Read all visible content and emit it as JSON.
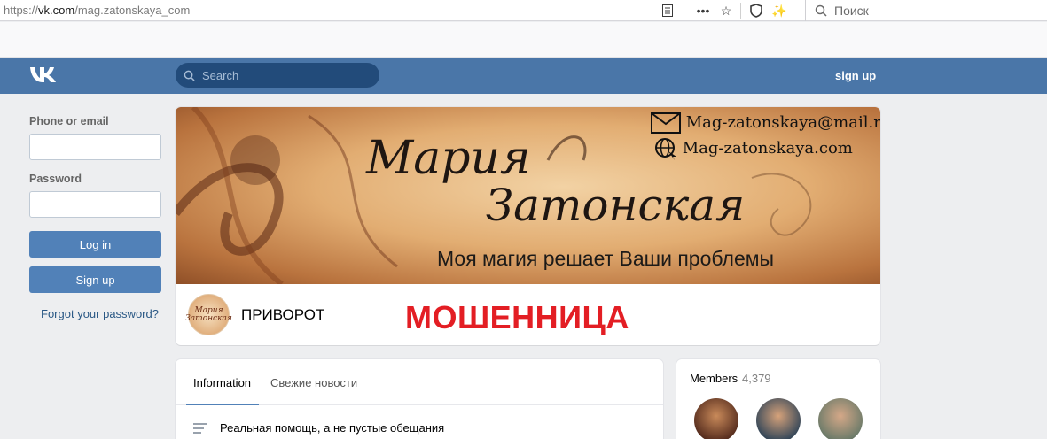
{
  "browser": {
    "url_prefix": "https://",
    "url_domain": "vk.com",
    "url_path": "/mag.zatonskaya_com",
    "search_placeholder": "Поиск"
  },
  "header": {
    "search_placeholder": "Search",
    "signup_label": "sign up"
  },
  "login": {
    "phone_label": "Phone or email",
    "password_label": "Password",
    "login_button": "Log in",
    "signup_button": "Sign up",
    "forgot_link": "Forgot your password?"
  },
  "cover": {
    "email": "Mag-zatonskaya@mail.ru",
    "site": "Mag-zatonskaya.com",
    "name_line1": "Мария",
    "name_line2": "Затонская",
    "slogan": "Моя магия решает Ваши проблемы"
  },
  "group": {
    "avatar_text": "Мария Затонская",
    "name": "ПРИВОРОТ",
    "overlay_label": "МОШЕННИЦА",
    "overlay_color": "#e31e24"
  },
  "info": {
    "tabs": [
      {
        "label": "Information"
      },
      {
        "label": "Свежие новости"
      }
    ],
    "description": "Реальная помощь, а не пустые обещания"
  },
  "members": {
    "title": "Members",
    "count": "4,379"
  },
  "colors": {
    "vk_blue": "#4a76a8",
    "button_blue": "#5181b8",
    "search_dark": "#224b7a"
  }
}
